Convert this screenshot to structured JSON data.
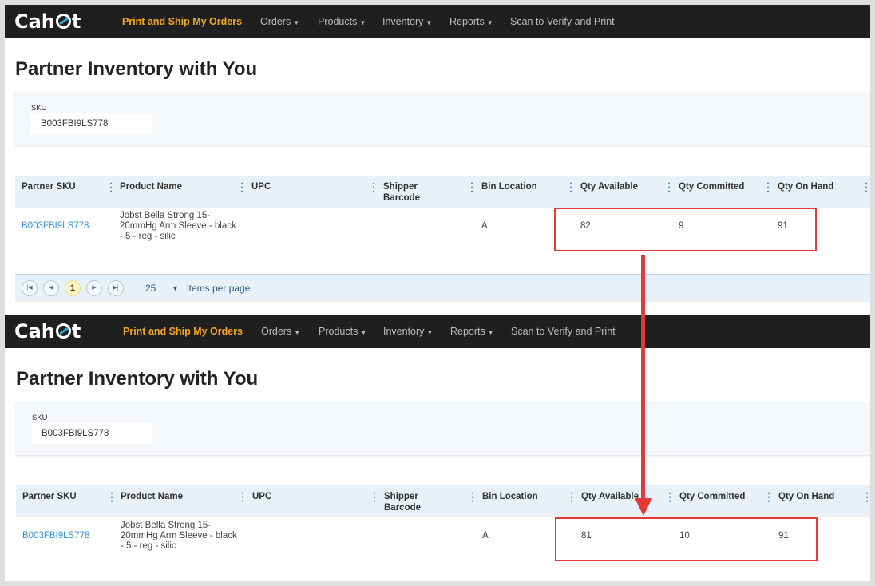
{
  "app": {
    "logo_text": "Cahoot"
  },
  "nav": {
    "active": "Print and Ship My Orders",
    "items": [
      "Orders",
      "Products",
      "Inventory",
      "Reports"
    ],
    "scan": "Scan to Verify and Print"
  },
  "page_title": "Partner Inventory with You",
  "filter": {
    "label": "SKU",
    "value": "B003FBI9LS778"
  },
  "columns": [
    "Partner SKU",
    "Product Name",
    "UPC",
    "Shipper Barcode",
    "Bin Location",
    "Qty Available",
    "Qty Committed",
    "Qty On Hand"
  ],
  "column_lines": {
    "shipper_1": "Shipper",
    "shipper_2": "Barcode"
  },
  "before": {
    "partner_sku": "B003FBI9LS778",
    "product_name_lines": [
      "Jobst Bella Strong 15-",
      "20mmHg Arm Sleeve - black",
      "- 5 - reg - silic"
    ],
    "upc": "",
    "bin": "A",
    "qty_available": "82",
    "qty_committed": "9",
    "qty_on_hand": "91"
  },
  "after": {
    "partner_sku": "B003FBI9LS778",
    "product_name_lines": [
      "Jobst Bella Strong 15-",
      "20mmHg Arm Sleeve - black",
      "- 5 - reg - silic"
    ],
    "upc": "",
    "bin": "A",
    "qty_available": "81",
    "qty_committed": "10",
    "qty_on_hand": "91"
  },
  "pager": {
    "current_page": "1",
    "page_size": "25",
    "label": "items per page"
  },
  "colors": {
    "nav_bg": "#1f1f1f",
    "active_nav": "#f5a623",
    "link": "#3a8fd6",
    "highlight": "#e53935"
  },
  "icons": [
    "first-page-icon",
    "prev-page-icon",
    "next-page-icon",
    "last-page-icon",
    "column-menu-icon",
    "dropdown-caret-icon"
  ]
}
